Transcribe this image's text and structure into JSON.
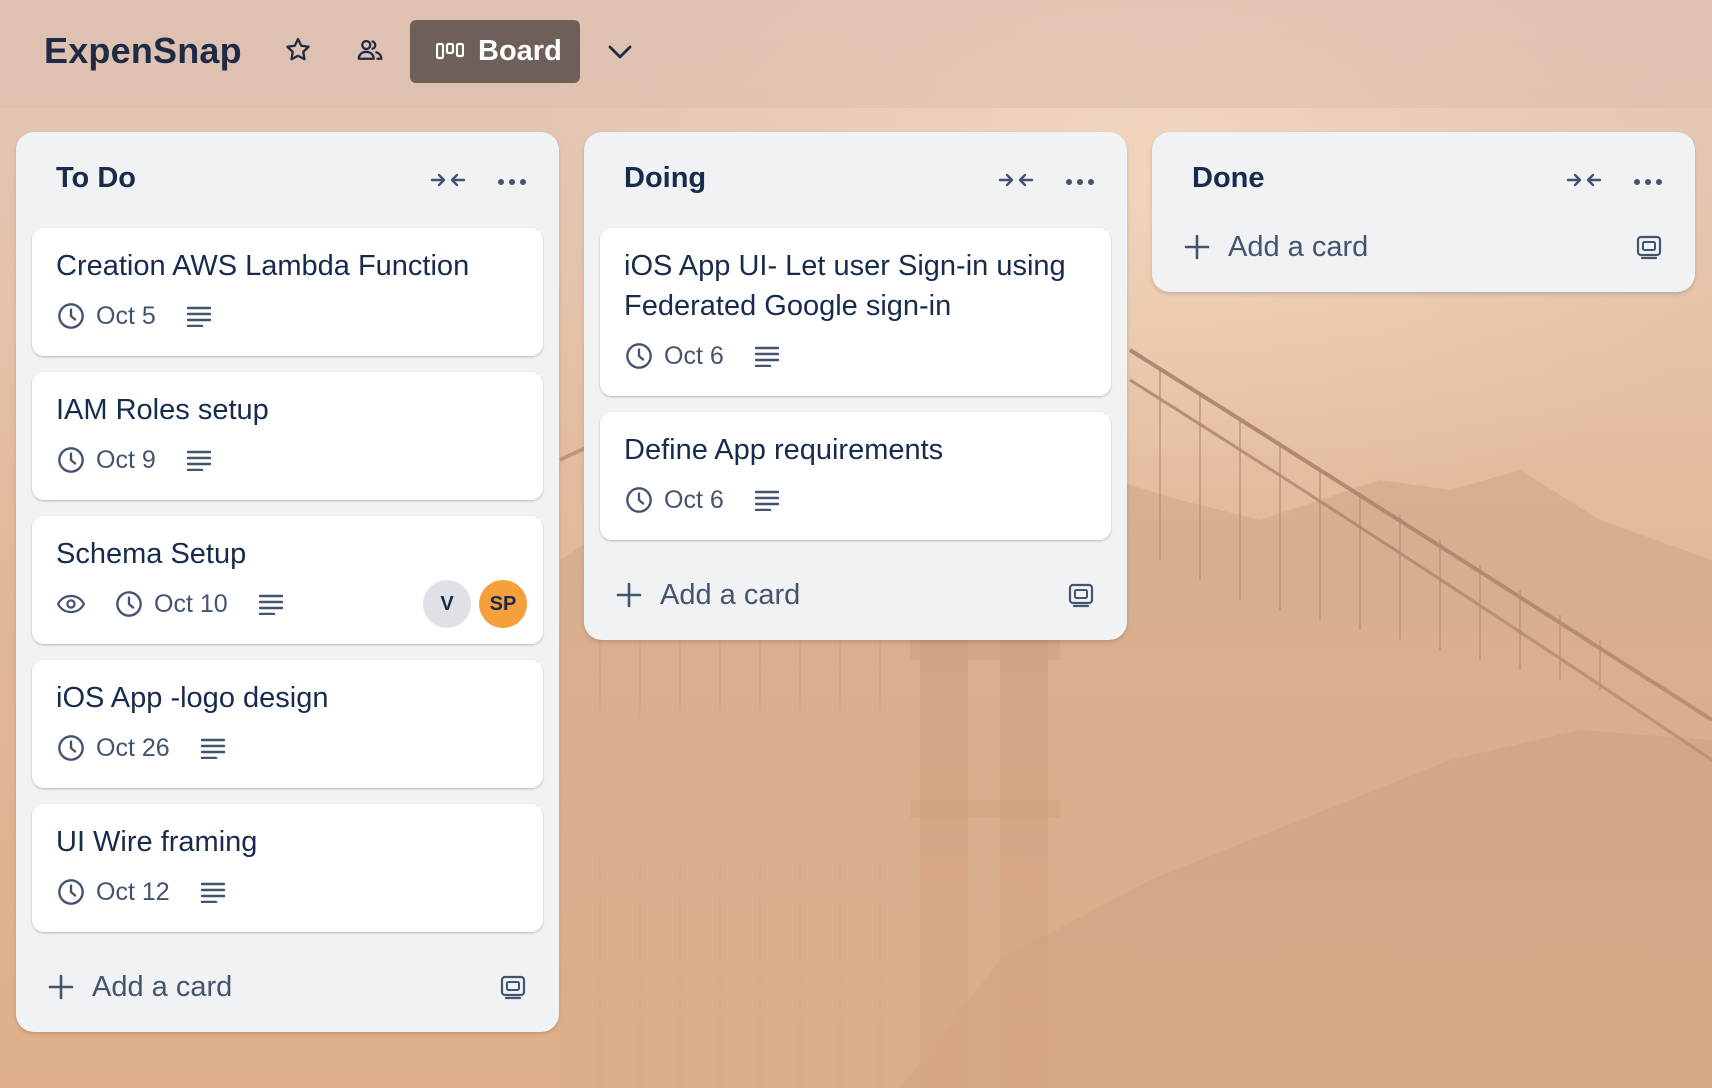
{
  "board": {
    "title": "ExpenSnap",
    "view_label": "Board",
    "icons": {
      "star": "star-icon",
      "visibility": "workspace-visible-icon",
      "view": "board-view-icon",
      "switcher": "chevron-down-icon"
    }
  },
  "lists": [
    {
      "title": "To Do",
      "add_label": "Add a card",
      "cards": [
        {
          "title": "Creation AWS Lambda Function",
          "date": "Oct 5",
          "has_description": true,
          "watching": false,
          "members": []
        },
        {
          "title": "IAM Roles setup",
          "date": "Oct 9",
          "has_description": true,
          "watching": false,
          "members": []
        },
        {
          "title": "Schema Setup",
          "date": "Oct 10",
          "has_description": true,
          "watching": true,
          "members": [
            {
              "initials": "V",
              "color": "#dfe1e6",
              "text_color": "#172b4d"
            },
            {
              "initials": "SP",
              "color": "#f5a03b",
              "text_color": "#172b4d"
            }
          ]
        },
        {
          "title": "iOS App -logo design",
          "date": "Oct 26",
          "has_description": true,
          "watching": false,
          "members": []
        },
        {
          "title": "UI Wire framing",
          "date": "Oct 12",
          "has_description": true,
          "watching": false,
          "members": []
        }
      ]
    },
    {
      "title": "Doing",
      "add_label": "Add a card",
      "cards": [
        {
          "title": "iOS App UI- Let user Sign-in using Federated Google sign-in",
          "date": "Oct 6",
          "has_description": true,
          "watching": false,
          "members": []
        },
        {
          "title": "Define App requirements",
          "date": "Oct 6",
          "has_description": true,
          "watching": false,
          "members": []
        }
      ]
    },
    {
      "title": "Done",
      "add_label": "Add a card",
      "cards": []
    }
  ],
  "colors": {
    "text_primary": "#172b4d",
    "text_subtle": "#44546f",
    "list_bg": "#f1f2f4",
    "view_button_bg": "#6e5f59"
  }
}
